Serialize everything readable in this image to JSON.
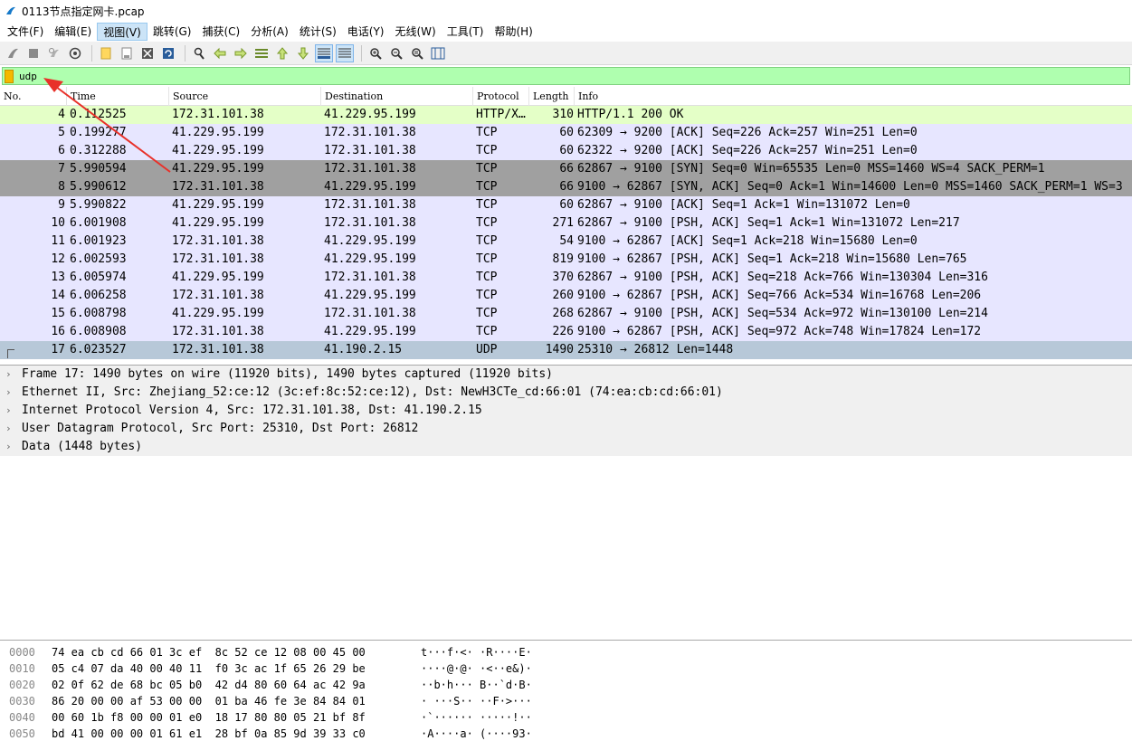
{
  "window": {
    "title": "0113节点指定网卡.pcap"
  },
  "menu": [
    "文件(F)",
    "编辑(E)",
    "视图(V)",
    "跳转(G)",
    "捕获(C)",
    "分析(A)",
    "统计(S)",
    "电话(Y)",
    "无线(W)",
    "工具(T)",
    "帮助(H)"
  ],
  "menu_active": "视图(V)",
  "toolbar_icons": [
    "shark-fin-start-icon",
    "stop-capture-icon",
    "restart-capture-icon",
    "capture-options-icon",
    "open-file-icon",
    "save-file-icon",
    "close-file-icon",
    "reload-file-icon",
    "find-packet-icon",
    "go-back-icon",
    "go-forward-icon",
    "go-to-packet-icon",
    "first-packet-icon",
    "last-packet-icon",
    "auto-scroll-icon",
    "colorize-icon",
    "zoom-in-icon",
    "zoom-out-icon",
    "normal-size-icon",
    "resize-columns-icon"
  ],
  "filter": {
    "value": "udp"
  },
  "columns": {
    "no": "No.",
    "time": "Time",
    "source": "Source",
    "destination": "Destination",
    "protocol": "Protocol",
    "length": "Length",
    "info": "Info"
  },
  "packets": [
    {
      "no": "4",
      "time": "0.112525",
      "source": "172.31.101.38",
      "destination": "41.229.95.199",
      "protocol": "HTTP/X…",
      "length": "310",
      "info": "HTTP/1.1 200 OK",
      "style": "http"
    },
    {
      "no": "5",
      "time": "0.199277",
      "source": "41.229.95.199",
      "destination": "172.31.101.38",
      "protocol": "TCP",
      "length": "60",
      "info": "62309 → 9200 [ACK] Seq=226 Ack=257 Win=251 Len=0",
      "style": "tcp"
    },
    {
      "no": "6",
      "time": "0.312288",
      "source": "41.229.95.199",
      "destination": "172.31.101.38",
      "protocol": "TCP",
      "length": "60",
      "info": "62322 → 9200 [ACK] Seq=226 Ack=257 Win=251 Len=0",
      "style": "tcp"
    },
    {
      "no": "7",
      "time": "5.990594",
      "source": "41.229.95.199",
      "destination": "172.31.101.38",
      "protocol": "TCP",
      "length": "66",
      "info": "62867 → 9100 [SYN] Seq=0 Win=65535 Len=0 MSS=1460 WS=4 SACK_PERM=1",
      "style": "syn"
    },
    {
      "no": "8",
      "time": "5.990612",
      "source": "172.31.101.38",
      "destination": "41.229.95.199",
      "protocol": "TCP",
      "length": "66",
      "info": "9100 → 62867 [SYN, ACK] Seq=0 Ack=1 Win=14600 Len=0 MSS=1460 SACK_PERM=1 WS=3",
      "style": "syn"
    },
    {
      "no": "9",
      "time": "5.990822",
      "source": "41.229.95.199",
      "destination": "172.31.101.38",
      "protocol": "TCP",
      "length": "60",
      "info": "62867 → 9100 [ACK] Seq=1 Ack=1 Win=131072 Len=0",
      "style": "tcp"
    },
    {
      "no": "10",
      "time": "6.001908",
      "source": "41.229.95.199",
      "destination": "172.31.101.38",
      "protocol": "TCP",
      "length": "271",
      "info": "62867 → 9100 [PSH, ACK] Seq=1 Ack=1 Win=131072 Len=217",
      "style": "tcp"
    },
    {
      "no": "11",
      "time": "6.001923",
      "source": "172.31.101.38",
      "destination": "41.229.95.199",
      "protocol": "TCP",
      "length": "54",
      "info": "9100 → 62867 [ACK] Seq=1 Ack=218 Win=15680 Len=0",
      "style": "tcp"
    },
    {
      "no": "12",
      "time": "6.002593",
      "source": "172.31.101.38",
      "destination": "41.229.95.199",
      "protocol": "TCP",
      "length": "819",
      "info": "9100 → 62867 [PSH, ACK] Seq=1 Ack=218 Win=15680 Len=765",
      "style": "tcp"
    },
    {
      "no": "13",
      "time": "6.005974",
      "source": "41.229.95.199",
      "destination": "172.31.101.38",
      "protocol": "TCP",
      "length": "370",
      "info": "62867 → 9100 [PSH, ACK] Seq=218 Ack=766 Win=130304 Len=316",
      "style": "tcp"
    },
    {
      "no": "14",
      "time": "6.006258",
      "source": "172.31.101.38",
      "destination": "41.229.95.199",
      "protocol": "TCP",
      "length": "260",
      "info": "9100 → 62867 [PSH, ACK] Seq=766 Ack=534 Win=16768 Len=206",
      "style": "tcp"
    },
    {
      "no": "15",
      "time": "6.008798",
      "source": "41.229.95.199",
      "destination": "172.31.101.38",
      "protocol": "TCP",
      "length": "268",
      "info": "62867 → 9100 [PSH, ACK] Seq=534 Ack=972 Win=130100 Len=214",
      "style": "tcp"
    },
    {
      "no": "16",
      "time": "6.008908",
      "source": "172.31.101.38",
      "destination": "41.229.95.199",
      "protocol": "TCP",
      "length": "226",
      "info": "9100 → 62867 [PSH, ACK] Seq=972 Ack=748 Win=17824 Len=172",
      "style": "tcp"
    },
    {
      "no": "17",
      "time": "6.023527",
      "source": "172.31.101.38",
      "destination": "41.190.2.15",
      "protocol": "UDP",
      "length": "1490",
      "info": "25310 → 26812 Len=1448",
      "style": "udp"
    }
  ],
  "details": [
    "Frame 17: 1490 bytes on wire (11920 bits), 1490 bytes captured (11920 bits)",
    "Ethernet II, Src: Zhejiang_52:ce:12 (3c:ef:8c:52:ce:12), Dst: NewH3CTe_cd:66:01 (74:ea:cb:cd:66:01)",
    "Internet Protocol Version 4, Src: 172.31.101.38, Dst: 41.190.2.15",
    "User Datagram Protocol, Src Port: 25310, Dst Port: 26812",
    "Data (1448 bytes)"
  ],
  "hex": [
    {
      "offset": "0000",
      "bytes": "74 ea cb cd 66 01 3c ef  8c 52 ce 12 08 00 45 00",
      "ascii": "t···f·<· ·R····E·"
    },
    {
      "offset": "0010",
      "bytes": "05 c4 07 da 40 00 40 11  f0 3c ac 1f 65 26 29 be",
      "ascii": "····@·@· ·<··e&)·"
    },
    {
      "offset": "0020",
      "bytes": "02 0f 62 de 68 bc 05 b0  42 d4 80 60 64 ac 42 9a",
      "ascii": "··b·h··· B··`d·B·"
    },
    {
      "offset": "0030",
      "bytes": "86 20 00 00 af 53 00 00  01 ba 46 fe 3e 84 84 01",
      "ascii": "· ···S·· ··F·>···"
    },
    {
      "offset": "0040",
      "bytes": "00 60 1b f8 00 00 01 e0  18 17 80 80 05 21 bf 8f",
      "ascii": "·`······ ·····!··"
    },
    {
      "offset": "0050",
      "bytes": "bd 41 00 00 00 01 61 e1  28 bf 0a 85 9d 39 33 c0",
      "ascii": "·A····a· (····93·"
    }
  ],
  "colors": {
    "http": "#e4ffc7",
    "tcp": "#e7e6ff",
    "syn": "#a0a0a0",
    "udp": "#b7c8d8",
    "filter_ok": "#afffaf",
    "arrow": "#e8312a"
  }
}
